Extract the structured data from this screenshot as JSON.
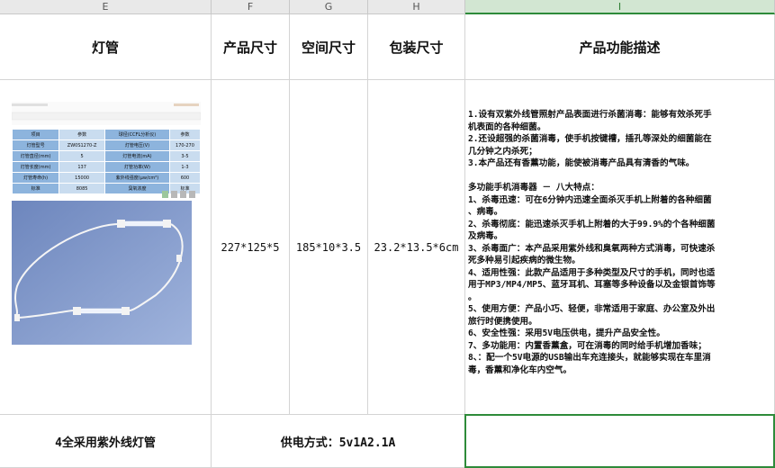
{
  "columns": [
    "E",
    "F",
    "G",
    "H",
    "I"
  ],
  "header_row": {
    "lamp": "灯管",
    "product_size": "产品尺寸",
    "space_size": "空间尺寸",
    "package_size": "包装尺寸",
    "description": "产品功能描述"
  },
  "row": {
    "product_size": "227*125*5",
    "space_size": "185*10*3.5",
    "package_size": "23.2*13.5*6cm",
    "description_lines": [
      "1.设有双紫外线管照射产品表面进行杀菌消毒：能够有效杀死手",
      "机表面的各种细菌。",
      "2.还设超强的杀菌消毒，使手机按键槽，插孔等深处的细菌能在",
      "几分钟之内杀死；",
      "3.本产品还有香薰功能，能使被消毒产品具有清香的气味。",
      "",
      "多功能手机消毒器 － 八大特点：",
      "1、杀毒迅速：可在6分钟内迅速全面杀灭手机上附着的各种细菌",
      "、病毒。",
      "2、杀毒彻底：能迅速杀灭手机上附着的大于99.9%的个各种细菌",
      "及病毒。",
      "3、杀毒面广：本产品采用紫外线和臭氧两种方式消毒，可快速杀",
      "死多种易引起疾病的微生物。",
      "4、适用性强：此款产品适用于多种类型及尺寸的手机，同时也适",
      "用于MP3/MP4/MP5、蓝牙耳机、耳塞等多种设备以及金银首饰等",
      "。",
      "5、使用方便：产品小巧、轻便，非常适用于家庭、办公室及外出",
      "旅行时便携使用。",
      "6、安全性强：采用5V电压供电，提升产品安全性。",
      "7、多功能用：内置香薰盒，可在消毒的同时给手机增加香味；",
      "8、：配一个5V电源的USB输出车充连接头，就能够实现在车里消",
      "毒，香薰和净化车内空气。"
    ]
  },
  "footer_row": {
    "lamp_note": "4全采用紫外线灯管",
    "power": "供电方式：5v1A2.1A"
  },
  "spec_table": {
    "rows": [
      [
        "项目",
        "参数",
        "球径(CCFL分析仪)",
        "参数"
      ],
      [
        "灯管型号",
        "ZW0S1270-Z",
        "灯管电压(V)",
        "170-270"
      ],
      [
        "灯管直径(mm)",
        "5",
        "灯管电流(mA)",
        "3-5"
      ],
      [
        "灯管长度(mm)",
        "137",
        "灯管功率(W)",
        "1-3"
      ],
      [
        "灯管寿命(h)",
        "15000",
        "紫外线强度(μw/cm²)",
        "600"
      ],
      [
        "标准",
        "8085",
        "臭氧浓度",
        "标准"
      ]
    ]
  },
  "colors": {
    "header_bg": "#e9e9e9",
    "selected": "#2e8b3a",
    "grid": "#d4d4d4"
  }
}
